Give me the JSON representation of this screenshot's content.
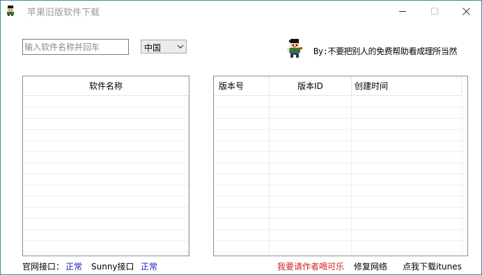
{
  "window": {
    "title": "苹果旧版软件下载",
    "icons": {
      "app": "mascot-icon",
      "minimize": "minimize-icon",
      "maximize": "maximize-icon",
      "close": "close-icon"
    }
  },
  "search": {
    "placeholder": "输入软件名称并回车",
    "value": ""
  },
  "region": {
    "selected": "中国",
    "icon": "chevron-down-icon"
  },
  "credit": {
    "text": "By:不要把别人的免费帮助看成理所当然",
    "icon": "mascot-icon"
  },
  "left_table": {
    "headers": [
      "软件名称"
    ],
    "rows": []
  },
  "right_table": {
    "headers": [
      "版本号",
      "版本ID",
      "创建时间"
    ],
    "rows": []
  },
  "footer": {
    "official_api_label": "官网接口：",
    "official_api_status": "正常",
    "sunny_api_label": "Sunny接口",
    "sunny_api_status": "正常",
    "donate_link": "我要请作者喝可乐",
    "repair_network": "修复网络",
    "download_itunes": "点我下载itunes"
  },
  "colors": {
    "status_ok": "#1f1fb8",
    "donate": "#d02020",
    "title_text": "#9a9a9a",
    "window_border": "#3c8c9c"
  }
}
